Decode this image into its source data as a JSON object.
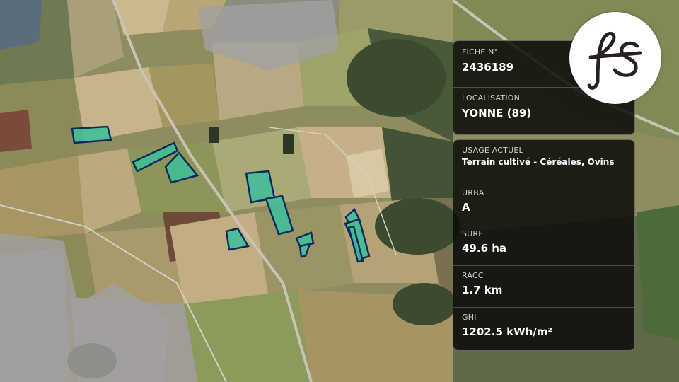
{
  "card_top": {
    "fiche_label": "FICHE N°",
    "fiche_value": "2436189",
    "localisation_label": "LOCALISATION",
    "localisation_value": "YONNE (89)"
  },
  "card_details": {
    "usage_label": "USAGE ACTUEL",
    "usage_value": "Terrain cultivé - Céréales, Ovins",
    "urba_label": "URBA",
    "urba_value": "A",
    "surf_label": "SURF",
    "surf_value": "49.6 ha",
    "racc_label": "RACC",
    "racc_value": "1.7 km",
    "ghi_label": "GHI",
    "ghi_value": "1202.5 kWh/m²"
  },
  "logo": {
    "text": "fs",
    "icon": "fs-monogram-logo"
  },
  "colors": {
    "parcel_fill": "#3dbf9a",
    "parcel_stroke": "#0e2a5c",
    "panel_bg": "#0c0a08"
  }
}
